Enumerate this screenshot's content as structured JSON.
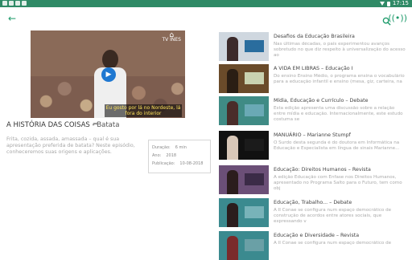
{
  "status_bar": {
    "time": "17:15"
  },
  "toolbar": {
    "back_icon": "arrow-left-icon",
    "search_icon": "search-icon",
    "broadcast_icon": "broadcast-icon",
    "accent": "#1e9b6b",
    "bar_color": "#2f8a66"
  },
  "player": {
    "caption": "Eu gosto por lá no Nordeste, lá fora do interior",
    "logo_text": "TV INES"
  },
  "video": {
    "title": "A HISTÓRIA DAS COISAS",
    "subtitle": "Batata",
    "separator": " - ",
    "description": "Frita, cozida, assada, amassada – qual é sua apresentação preferida de batata? Neste episódio, conheceremos suas origens e aplicações.",
    "meta": [
      {
        "label": "Duração:",
        "value": "6 min"
      },
      {
        "label": "Ano:",
        "value": "2018"
      },
      {
        "label": "Publicação:",
        "value": "10-08-2018"
      }
    ]
  },
  "list": [
    {
      "title": "Desafios da Educação Brasileira",
      "description": "Nas últimas décadas, o país experimentou avanços sobretudo no que diz respeito à universalização do acesso ao",
      "thumb_bg": "#cfd7df",
      "screen": "#2a6d9e",
      "fig": "#3c2b2b"
    },
    {
      "title": "A VIDA EM LIBRAS – Educação I",
      "description": "Do ensino Ensino Médio, o programa ensina o vocabulário para a educação infantil e ensino (mesa, giz, carteira, na",
      "thumb_bg": "#6a4b2a",
      "screen": "#c9d2b0",
      "fig": "#2a1e14"
    },
    {
      "title": "Mídia, Educação e Currículo – Debate",
      "description": "Esta edição apresenta uma discussão sobre a relação entre mídia e educação. Internacionalmente, este estudo costuma se",
      "thumb_bg": "#3f8b85",
      "screen": "#6aa9b5",
      "fig": "#4a2d2a"
    },
    {
      "title": "MANUÁRIO – Marianne Stumpf",
      "description": "O Surdo desta segunda é do doutora em Informática na Educação e Especialista em língua de sinais Marianne...",
      "thumb_bg": "#111111",
      "screen": "#1b1b1b",
      "fig": "#d8c7b8"
    },
    {
      "title": "Educação: Direitos Humanos – Revista",
      "description": "A edição Educação com Enfase nos Direitos Humanos, apresentado no Programa Salto para o Futuro, tem como obj",
      "thumb_bg": "#6b4f77",
      "screen": "#3b2b47",
      "fig": "#2b1d1d"
    },
    {
      "title": "Educação, Trabalho... – Debate",
      "description": "A II Conae se configura num espaço democrático de construção de acordos entre atores sociais, que expressando v",
      "thumb_bg": "#3b8a8f",
      "screen": "#78b3b9",
      "fig": "#2b1d1d"
    },
    {
      "title": "Educação e Diversidade – Revista",
      "description": "A II Conae se configura num espaço democrático de",
      "thumb_bg": "#3b8a8f",
      "screen": "#6aa0a6",
      "fig": "#7a2b2b"
    }
  ]
}
